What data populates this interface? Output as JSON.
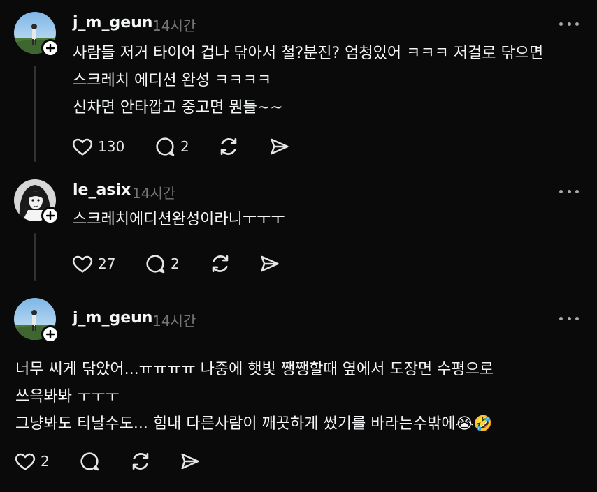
{
  "posts": [
    {
      "username": "j_m_geun",
      "time": "14시간",
      "lines": [
        "사람들 저거 타이어 겁나 닦아서 철?분진? 엄청있어 ㅋㅋㅋ 저걸로 닦으면",
        "스크레치 에디션 완성 ㅋㅋㅋㅋ",
        "신차면 안타깝고 중고면 뭔들~~"
      ],
      "likes": "130",
      "comments": "2"
    },
    {
      "username": "le_asix",
      "time": "14시간",
      "lines": [
        "스크레치에디션완성이라니ㅜㅜㅜ"
      ],
      "likes": "27",
      "comments": "2"
    },
    {
      "username": "j_m_geun",
      "time": "14시간",
      "lines": [
        "너무 씨게 닦았어...ㅠㅠㅠㅠ 나중에 햇빛 쨍쨍할때 옆에서 도장면 수평으로",
        "쓰윽봐봐 ㅜㅜㅜ",
        "그냥봐도 티날수도... 힘내 다른사람이 깨끗하게 썼기를 바라는수밖에"
      ],
      "likes": "2",
      "comments": ""
    }
  ],
  "emojis": [
    "😭",
    "🤣"
  ],
  "icons": {
    "like": "heart-icon",
    "comment": "comment-icon",
    "repost": "repost-icon",
    "share": "send-icon",
    "more": "more-icon",
    "follow": "plus-icon"
  },
  "colors": {
    "background": "#0a0a0a",
    "text": "#f3f5f7",
    "muted": "#777777",
    "thread_line": "#333333"
  }
}
